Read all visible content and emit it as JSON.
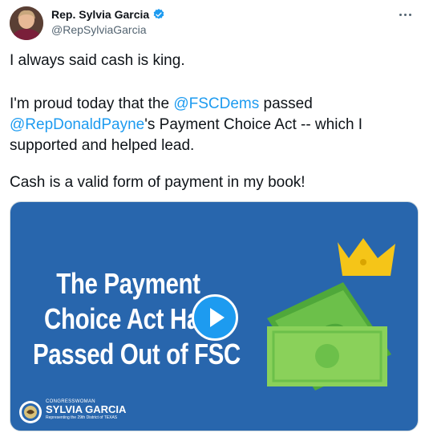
{
  "author": {
    "name": "Rep. Sylvia Garcia",
    "handle": "@RepSylviaGarcia"
  },
  "tweet": {
    "line1": "I always said cash is king.",
    "line2_pre": "I'm proud today that the ",
    "line2_link": "@FSCDems",
    "line2_post": " passed",
    "line3_link": "@RepDonaldPayne",
    "line3_post": "'s Payment Choice Act -- which I",
    "line4": "supported and helped lead.",
    "line5": "Cash is a valid form of payment in my book!"
  },
  "media": {
    "headline_lines": [
      "The Payment",
      "Choice Act Has",
      "Passed Out of FSC"
    ],
    "brand_small": "CONGRESSWOMAN",
    "brand_big": "SYLVIA GARCIA",
    "brand_tag": "Representing the 29th District of TEXAS"
  },
  "colors": {
    "link": "#1d9bf0",
    "media_background": "#2866ad",
    "crown": "#f5c518",
    "money": "#6cc04a"
  },
  "icons": {
    "verified": "verified-badge-icon",
    "more": "more-options-icon",
    "play": "play-icon"
  }
}
